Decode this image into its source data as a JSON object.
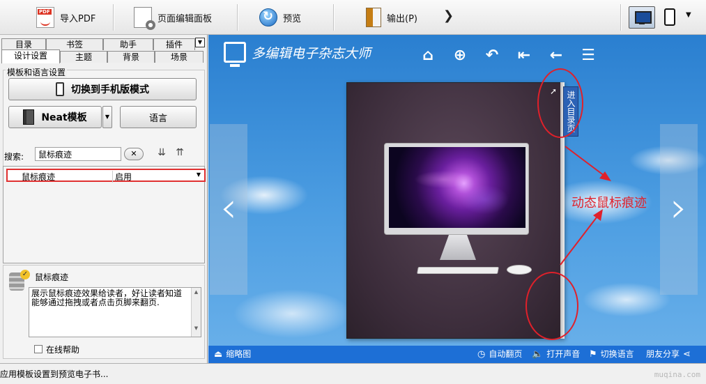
{
  "toolbar": {
    "import_pdf": "导入PDF",
    "page_editor": "页面编辑面板",
    "preview": "预览",
    "output": "输出(P)",
    "more": "❯",
    "pdf_icon_text": "PDF"
  },
  "left_panel": {
    "tabs_row1": [
      "目录",
      "书签",
      "助手",
      "插件"
    ],
    "tabs_row2": [
      "设计设置",
      "主题",
      "背景",
      "场景"
    ],
    "active_tab": "设计设置",
    "group_title": "模板和语言设置",
    "switch_mobile": "切换到手机版模式",
    "template": "Neat模板",
    "language": "语言",
    "search_label": "搜索:",
    "search_value": "鼠标痕迹",
    "clear_icon": "✕",
    "sort_down_icon": "⇊",
    "sort_up_icon": "⇈",
    "property": {
      "name": "鼠标痕迹",
      "value": "启用"
    },
    "desc_title": "鼠标痕迹",
    "desc_text": "展示鼠标痕迹效果给读者，好让读者知道能够通过拖拽或者点击页脚来翻页.",
    "help_label": "在线帮助"
  },
  "preview": {
    "brand": "多编辑电子杂志大师",
    "nav_icons": [
      "⌂",
      "⊕",
      "↶",
      "⇤",
      "←",
      "☰"
    ],
    "toc_tab": "进入目录页",
    "annotation": "动态鼠标痕迹",
    "accent_color": "#e0202a",
    "bar_color": "#1d6fd6",
    "bottom_bar": {
      "thumbnails": "缩略图",
      "auto_flip": "自动翻页",
      "sound": "打开声音",
      "switch_lang": "切换语言",
      "share": "朋友分享"
    }
  },
  "status_text": "应用模板设置到预览电子书...",
  "watermark": "muqina.com"
}
